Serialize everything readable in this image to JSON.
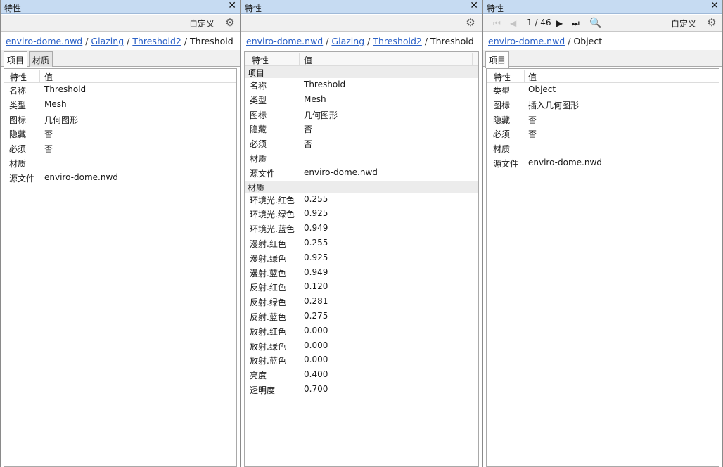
{
  "panel_title": "特性",
  "customize_label": "自定义",
  "panel1": {
    "breadcrumb": {
      "links": [
        "enviro-dome.nwd",
        "Glazing",
        "Threshold2"
      ],
      "current": "Threshold"
    },
    "tabs": [
      "项目",
      "材质"
    ],
    "columns": [
      "特性",
      "值"
    ],
    "rows": [
      {
        "k": "名称",
        "v": "Threshold"
      },
      {
        "k": "类型",
        "v": "Mesh"
      },
      {
        "k": "图标",
        "v": "几何图形"
      },
      {
        "k": "隐藏",
        "v": "否"
      },
      {
        "k": "必须",
        "v": "否"
      },
      {
        "k": "材质",
        "v": ""
      },
      {
        "k": "源文件",
        "v": "enviro-dome.nwd"
      }
    ]
  },
  "panel2": {
    "breadcrumb": {
      "links": [
        "enviro-dome.nwd",
        "Glazing",
        "Threshold2"
      ],
      "current": "Threshold"
    },
    "columns": [
      "特性",
      "值"
    ],
    "sections": [
      {
        "title": "项目",
        "rows": [
          {
            "k": "名称",
            "v": "Threshold"
          },
          {
            "k": "类型",
            "v": "Mesh"
          },
          {
            "k": "图标",
            "v": "几何图形"
          },
          {
            "k": "隐藏",
            "v": "否"
          },
          {
            "k": "必须",
            "v": "否"
          },
          {
            "k": "材质",
            "v": ""
          },
          {
            "k": "源文件",
            "v": "enviro-dome.nwd"
          }
        ]
      },
      {
        "title": "材质",
        "rows": [
          {
            "k": "环境光.红色",
            "v": "0.255"
          },
          {
            "k": "环境光.绿色",
            "v": "0.925"
          },
          {
            "k": "环境光.蓝色",
            "v": "0.949"
          },
          {
            "k": "漫射.红色",
            "v": "0.255"
          },
          {
            "k": "漫射.绿色",
            "v": "0.925"
          },
          {
            "k": "漫射.蓝色",
            "v": "0.949"
          },
          {
            "k": "反射.红色",
            "v": "0.120"
          },
          {
            "k": "反射.绿色",
            "v": "0.281"
          },
          {
            "k": "反射.蓝色",
            "v": "0.275"
          },
          {
            "k": "放射.红色",
            "v": "0.000"
          },
          {
            "k": "放射.绿色",
            "v": "0.000"
          },
          {
            "k": "放射.蓝色",
            "v": "0.000"
          },
          {
            "k": "亮度",
            "v": "0.400"
          },
          {
            "k": "透明度",
            "v": "0.700"
          }
        ]
      }
    ]
  },
  "panel3": {
    "pager": {
      "text": "1 / 46"
    },
    "breadcrumb": {
      "links": [
        "enviro-dome.nwd"
      ],
      "current": "Object"
    },
    "tabs": [
      "项目"
    ],
    "columns": [
      "特性",
      "值"
    ],
    "rows": [
      {
        "k": "类型",
        "v": "Object"
      },
      {
        "k": "图标",
        "v": "插入几何图形"
      },
      {
        "k": "隐藏",
        "v": "否"
      },
      {
        "k": "必须",
        "v": "否"
      },
      {
        "k": "材质",
        "v": ""
      },
      {
        "k": "源文件",
        "v": "enviro-dome.nwd"
      }
    ]
  },
  "icons": {
    "close": "close-icon",
    "settings": "gear-icon",
    "search": "search-icon",
    "first": "first-page-icon",
    "prev": "prev-page-icon",
    "next": "next-page-icon",
    "last": "last-page-icon"
  },
  "colors": {
    "titlebar": "#c6dbf2",
    "link": "#2d62c7",
    "section": "#ececec"
  }
}
